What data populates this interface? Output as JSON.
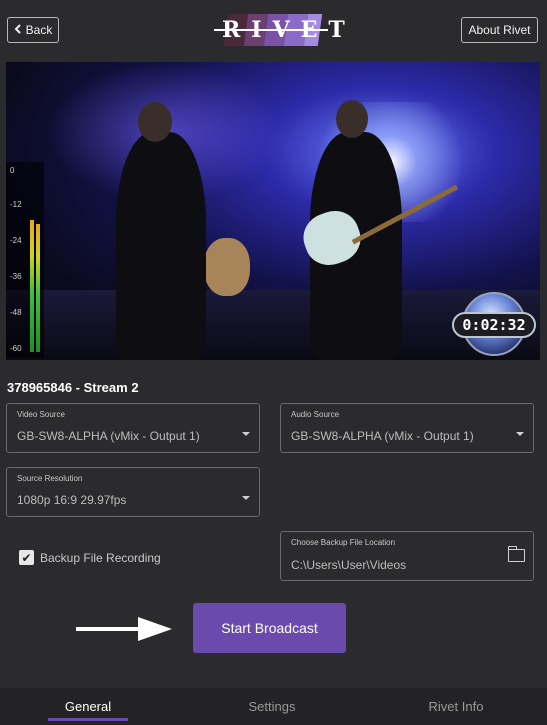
{
  "header": {
    "back_label": "Back",
    "about_label": "About Rivet",
    "logo_text": "RIVET",
    "logo_colors": [
      "#4a2a3a",
      "#6b3f6f",
      "#7a52a8",
      "#8a6cc8",
      "#a48ae0"
    ]
  },
  "video": {
    "timer": "0:02:32",
    "vu_ticks": [
      "0",
      "-12",
      "-24",
      "-36",
      "-48",
      "-60"
    ]
  },
  "stream": {
    "title": "378965846 - Stream 2"
  },
  "form": {
    "video_source": {
      "label": "Video Source",
      "value": "GB-SW8-ALPHA (vMix - Output 1)"
    },
    "audio_source": {
      "label": "Audio Source",
      "value": "GB-SW8-ALPHA (vMix - Output 1)"
    },
    "source_resolution": {
      "label": "Source Resolution",
      "value": "1080p 16:9 29.97fps"
    },
    "backup_recording": {
      "label": "Backup File Recording",
      "checked": true
    },
    "backup_location": {
      "label": "Choose Backup File Location",
      "value": "C:\\Users\\User\\Videos"
    }
  },
  "actions": {
    "start_label": "Start Broadcast"
  },
  "nav": {
    "tabs": [
      "General",
      "Settings",
      "Rivet Info"
    ],
    "active": "General"
  },
  "colors": {
    "accent": "#6a4aad",
    "background": "#2b2b2d"
  }
}
